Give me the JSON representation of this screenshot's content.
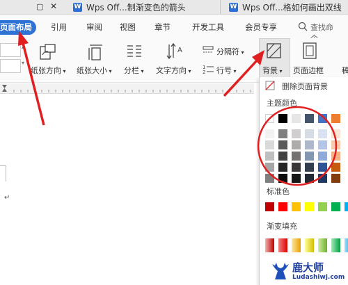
{
  "tabs": [
    {
      "label": "Wps Off...制渐变色的箭头"
    },
    {
      "label": "Wps Off...格如何画出双线"
    }
  ],
  "menu": [
    {
      "label": "页面布局"
    },
    {
      "label": "引用"
    },
    {
      "label": "审阅"
    },
    {
      "label": "视图"
    },
    {
      "label": "章节"
    },
    {
      "label": "开发工具"
    },
    {
      "label": "会员专享"
    }
  ],
  "search": {
    "placeholder": "查找命令、"
  },
  "ribbon": {
    "orientation": "纸张方向",
    "size": "纸张大小",
    "columns": "分栏",
    "text_direction": "文字方向",
    "separator": "分隔符",
    "line_number": "行号",
    "background": "背景",
    "page_border": "页面边框",
    "more": "稿"
  },
  "panel": {
    "delete_bg": "删除页面背景",
    "theme_colors": "主题颜色",
    "standard_colors": "标准色",
    "gradient_fill": "渐变填充"
  },
  "colors": {
    "accent": "#2e72d6",
    "annotation": "#e02020",
    "theme_top": [
      "#ffffff",
      "#000000",
      "#e7e6e6",
      "#44546a",
      "#4472c4",
      "#ed7d31"
    ],
    "standard": [
      "#c00000",
      "#ff0000",
      "#ffc000",
      "#ffff00",
      "#92d050",
      "#00b050",
      "#00b0f0"
    ]
  },
  "watermark": {
    "brand": "鹿大师",
    "url": "Ludashiwj.com"
  }
}
